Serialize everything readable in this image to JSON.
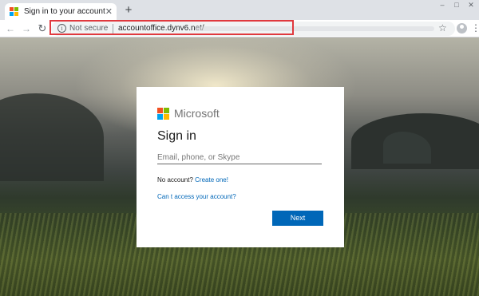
{
  "browser": {
    "tab": {
      "title": "Sign in to your account",
      "close_glyph": "✕",
      "favicon": "microsoft-logo"
    },
    "new_tab_glyph": "+",
    "window_controls": [
      "–",
      "□",
      "✕"
    ],
    "toolbar": {
      "back_glyph": "←",
      "forward_glyph": "→",
      "reload_glyph": "↻",
      "security_icon_glyph": "i",
      "security_text": "Not secure",
      "url": "accountoffice.dynv6.net/",
      "star_glyph": "☆",
      "menu_glyph": "⋮"
    },
    "highlight_color": "#e0393e"
  },
  "brand_colors": {
    "ms_red": "#f25022",
    "ms_green": "#7fba00",
    "ms_blue": "#00a4ef",
    "ms_yellow": "#ffb900",
    "link_blue": "#0067b8"
  },
  "signin": {
    "brand": "Microsoft",
    "title": "Sign in",
    "email_placeholder": "Email, phone, or Skype",
    "no_account_text": "No account?",
    "create_link": "Create one!",
    "cant_access": "Can t access your account?",
    "next_label": "Next"
  }
}
